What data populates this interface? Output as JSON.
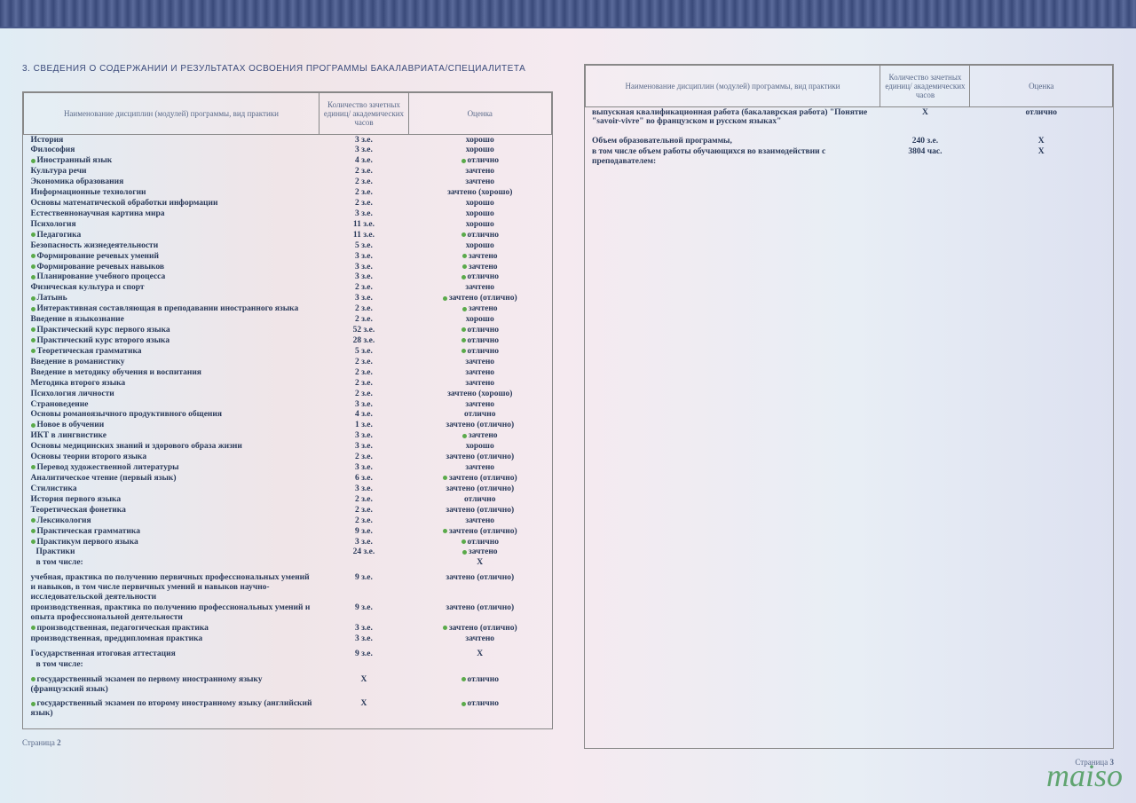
{
  "section_title": "3. СВЕДЕНИЯ О СОДЕРЖАНИИ И РЕЗУЛЬТАТАХ ОСВОЕНИЯ ПРОГРАММЫ БАКАЛАВРИАТА/СПЕЦИАЛИТЕТА",
  "col_headers": {
    "name": "Наименование дисциплин (модулей) программы, вид практики",
    "credits": "Количество зачетных единиц/ академических часов",
    "grade": "Оценка"
  },
  "left_rows": [
    {
      "name": "История",
      "credits": "3 з.е.",
      "grade": "хорошо",
      "dn": false,
      "dg": false
    },
    {
      "name": "Философия",
      "credits": "3 з.е.",
      "grade": "хорошо",
      "dn": false,
      "dg": false
    },
    {
      "name": "Иностранный язык",
      "credits": "4 з.е.",
      "grade": "отлично",
      "dn": true,
      "dg": true
    },
    {
      "name": "Культура речи",
      "credits": "2 з.е.",
      "grade": "зачтено",
      "dn": false,
      "dg": false
    },
    {
      "name": "Экономика образования",
      "credits": "2 з.е.",
      "grade": "зачтено",
      "dn": false,
      "dg": false
    },
    {
      "name": "Информационные технологии",
      "credits": "2 з.е.",
      "grade": "зачтено (хорошо)",
      "dn": false,
      "dg": false
    },
    {
      "name": "Основы математической обработки информации",
      "credits": "2 з.е.",
      "grade": "хорошо",
      "dn": false,
      "dg": false
    },
    {
      "name": "Естественнонаучная картина мира",
      "credits": "3 з.е.",
      "grade": "хорошо",
      "dn": false,
      "dg": false
    },
    {
      "name": "Психология",
      "credits": "11 з.е.",
      "grade": "хорошо",
      "dn": false,
      "dg": false
    },
    {
      "name": "Педагогика",
      "credits": "11 з.е.",
      "grade": "отлично",
      "dn": true,
      "dg": true
    },
    {
      "name": "Безопасность жизнедеятельности",
      "credits": "5 з.е.",
      "grade": "хорошо",
      "dn": false,
      "dg": false
    },
    {
      "name": "Формирование речевых умений",
      "credits": "3 з.е.",
      "grade": "зачтено",
      "dn": true,
      "dg": true
    },
    {
      "name": "Формирование речевых навыков",
      "credits": "3 з.е.",
      "grade": "зачтено",
      "dn": true,
      "dg": true
    },
    {
      "name": "Планирование учебного процесса",
      "credits": "3 з.е.",
      "grade": "отлично",
      "dn": true,
      "dg": true
    },
    {
      "name": "Физическая культура и спорт",
      "credits": "2 з.е.",
      "grade": "зачтено",
      "dn": false,
      "dg": false
    },
    {
      "name": "Латынь",
      "credits": "3 з.е.",
      "grade": "зачтено (отлично)",
      "dn": true,
      "dg": true
    },
    {
      "name": "Интерактивная составляющая в преподавании иностранного языка",
      "credits": "2 з.е.",
      "grade": "зачтено",
      "dn": true,
      "dg": true
    },
    {
      "name": "Введение в языкознание",
      "credits": "2 з.е.",
      "grade": "хорошо",
      "dn": false,
      "dg": false
    },
    {
      "name": "Практический курс первого языка",
      "credits": "52 з.е.",
      "grade": "отлично",
      "dn": true,
      "dg": true
    },
    {
      "name": "Практический курс второго языка",
      "credits": "28 з.е.",
      "grade": "отлично",
      "dn": true,
      "dg": true
    },
    {
      "name": "Теоретическая грамматика",
      "credits": "5 з.е.",
      "grade": "отлично",
      "dn": true,
      "dg": true
    },
    {
      "name": "Введение в романистику",
      "credits": "2 з.е.",
      "grade": "зачтено",
      "dn": false,
      "dg": false
    },
    {
      "name": "Введение в методику обучения и воспитания",
      "credits": "2 з.е.",
      "grade": "зачтено",
      "dn": false,
      "dg": false
    },
    {
      "name": "Методика второго языка",
      "credits": "2 з.е.",
      "grade": "зачтено",
      "dn": false,
      "dg": false
    },
    {
      "name": "Психология личности",
      "credits": "2 з.е.",
      "grade": "зачтено (хорошо)",
      "dn": false,
      "dg": false
    },
    {
      "name": "Страноведение",
      "credits": "3 з.е.",
      "grade": "зачтено",
      "dn": false,
      "dg": false
    },
    {
      "name": "Основы романоязычного продуктивного общения",
      "credits": "4 з.е.",
      "grade": "отлично",
      "dn": false,
      "dg": false
    },
    {
      "name": "Новое в обучении",
      "credits": "1 з.е.",
      "grade": "зачтено (отлично)",
      "dn": true,
      "dg": false
    },
    {
      "name": "ИКТ в лингвистике",
      "credits": "3 з.е.",
      "grade": "зачтено",
      "dn": false,
      "dg": true
    },
    {
      "name": "Основы медицинских знаний и здорового образа жизни",
      "credits": "3 з.е.",
      "grade": "хорошо",
      "dn": false,
      "dg": false
    },
    {
      "name": "Основы теории второго языка",
      "credits": "2 з.е.",
      "grade": "зачтено (отлично)",
      "dn": false,
      "dg": false
    },
    {
      "name": "Перевод художественной литературы",
      "credits": "3 з.е.",
      "grade": "зачтено",
      "dn": true,
      "dg": false
    },
    {
      "name": "Аналитическое чтение (первый язык)",
      "credits": "6 з.е.",
      "grade": "зачтено (отлично)",
      "dn": false,
      "dg": true
    },
    {
      "name": "Стилистика",
      "credits": "3 з.е.",
      "grade": "зачтено (отлично)",
      "dn": false,
      "dg": false
    },
    {
      "name": "История первого языка",
      "credits": "2 з.е.",
      "grade": "отлично",
      "dn": false,
      "dg": false
    },
    {
      "name": "Теоретическая фонетика",
      "credits": "2 з.е.",
      "grade": "зачтено (отлично)",
      "dn": false,
      "dg": false
    },
    {
      "name": "Лексикология",
      "credits": "2 з.е.",
      "grade": "зачтено",
      "dn": true,
      "dg": false
    },
    {
      "name": "Практическая грамматика",
      "credits": "9 з.е.",
      "grade": "зачтено (отлично)",
      "dn": true,
      "dg": true
    },
    {
      "name": "Практикум первого языка",
      "credits": "3 з.е.",
      "grade": "отлично",
      "dn": true,
      "dg": true
    },
    {
      "name": "Практики",
      "credits": "24 з.е.",
      "grade": "зачтено",
      "dn": false,
      "dg": true,
      "indent": true
    },
    {
      "name": "в том числе:",
      "credits": "",
      "grade": "X",
      "dn": false,
      "dg": false,
      "indent": true,
      "sub": true
    },
    {
      "spacer": true
    },
    {
      "name": "учебная, практика по получению первичных профессиональных умений и навыков, в том числе первичных умений и навыков научно-исследовательской деятельности",
      "credits": "9 з.е.",
      "grade": "зачтено (отлично)",
      "dn": false,
      "dg": false
    },
    {
      "name": "производственная, практика по получению профессиональных умений и опыта профессиональной деятельности",
      "credits": "9 з.е.",
      "grade": "зачтено (отлично)",
      "dn": false,
      "dg": false
    },
    {
      "name": "производственная, педагогическая практика",
      "credits": "3 з.е.",
      "grade": "зачтено (отлично)",
      "dn": true,
      "dg": true
    },
    {
      "name": "производственная, преддипломная практика",
      "credits": "3 з.е.",
      "grade": "зачтено",
      "dn": false,
      "dg": false
    },
    {
      "spacer": true
    },
    {
      "name": "Государственная итоговая аттестация",
      "credits": "9 з.е.",
      "grade": "X",
      "dn": false,
      "dg": false
    },
    {
      "name": "в том числе:",
      "credits": "",
      "grade": "",
      "dn": false,
      "dg": false,
      "indent": true,
      "sub": true
    },
    {
      "spacer": true
    },
    {
      "name": "государственный экзамен по первому иностранному языку (французский язык)",
      "credits": "X",
      "grade": "отлично",
      "dn": true,
      "dg": true
    },
    {
      "spacer": true
    },
    {
      "name": "государственный экзамен по второму иностранному языку (английский язык)",
      "credits": "X",
      "grade": "отлично",
      "dn": true,
      "dg": true
    }
  ],
  "right_rows": [
    {
      "name": "выпускная квалификационная работа (бакалаврская работа) \"Понятие \"savoir-vivre\" во французском и русском языках\"",
      "credits": "X",
      "grade": "отлично",
      "dn": false,
      "dg": false
    },
    {
      "spacer": true
    },
    {
      "spacer": true
    },
    {
      "name": "Объем образовательной программы,",
      "credits": "240 з.е.",
      "grade": "X",
      "dn": false,
      "dg": false
    },
    {
      "name": "в том числе объем работы обучающихся во взаимодействии с преподавателем:",
      "credits": "3804 час.",
      "grade": "X",
      "dn": false,
      "dg": false
    }
  ],
  "page_left_label": "Страница",
  "page_left_num": "2",
  "page_right_label": "Страница",
  "page_right_num": "3",
  "watermark": "maiso"
}
